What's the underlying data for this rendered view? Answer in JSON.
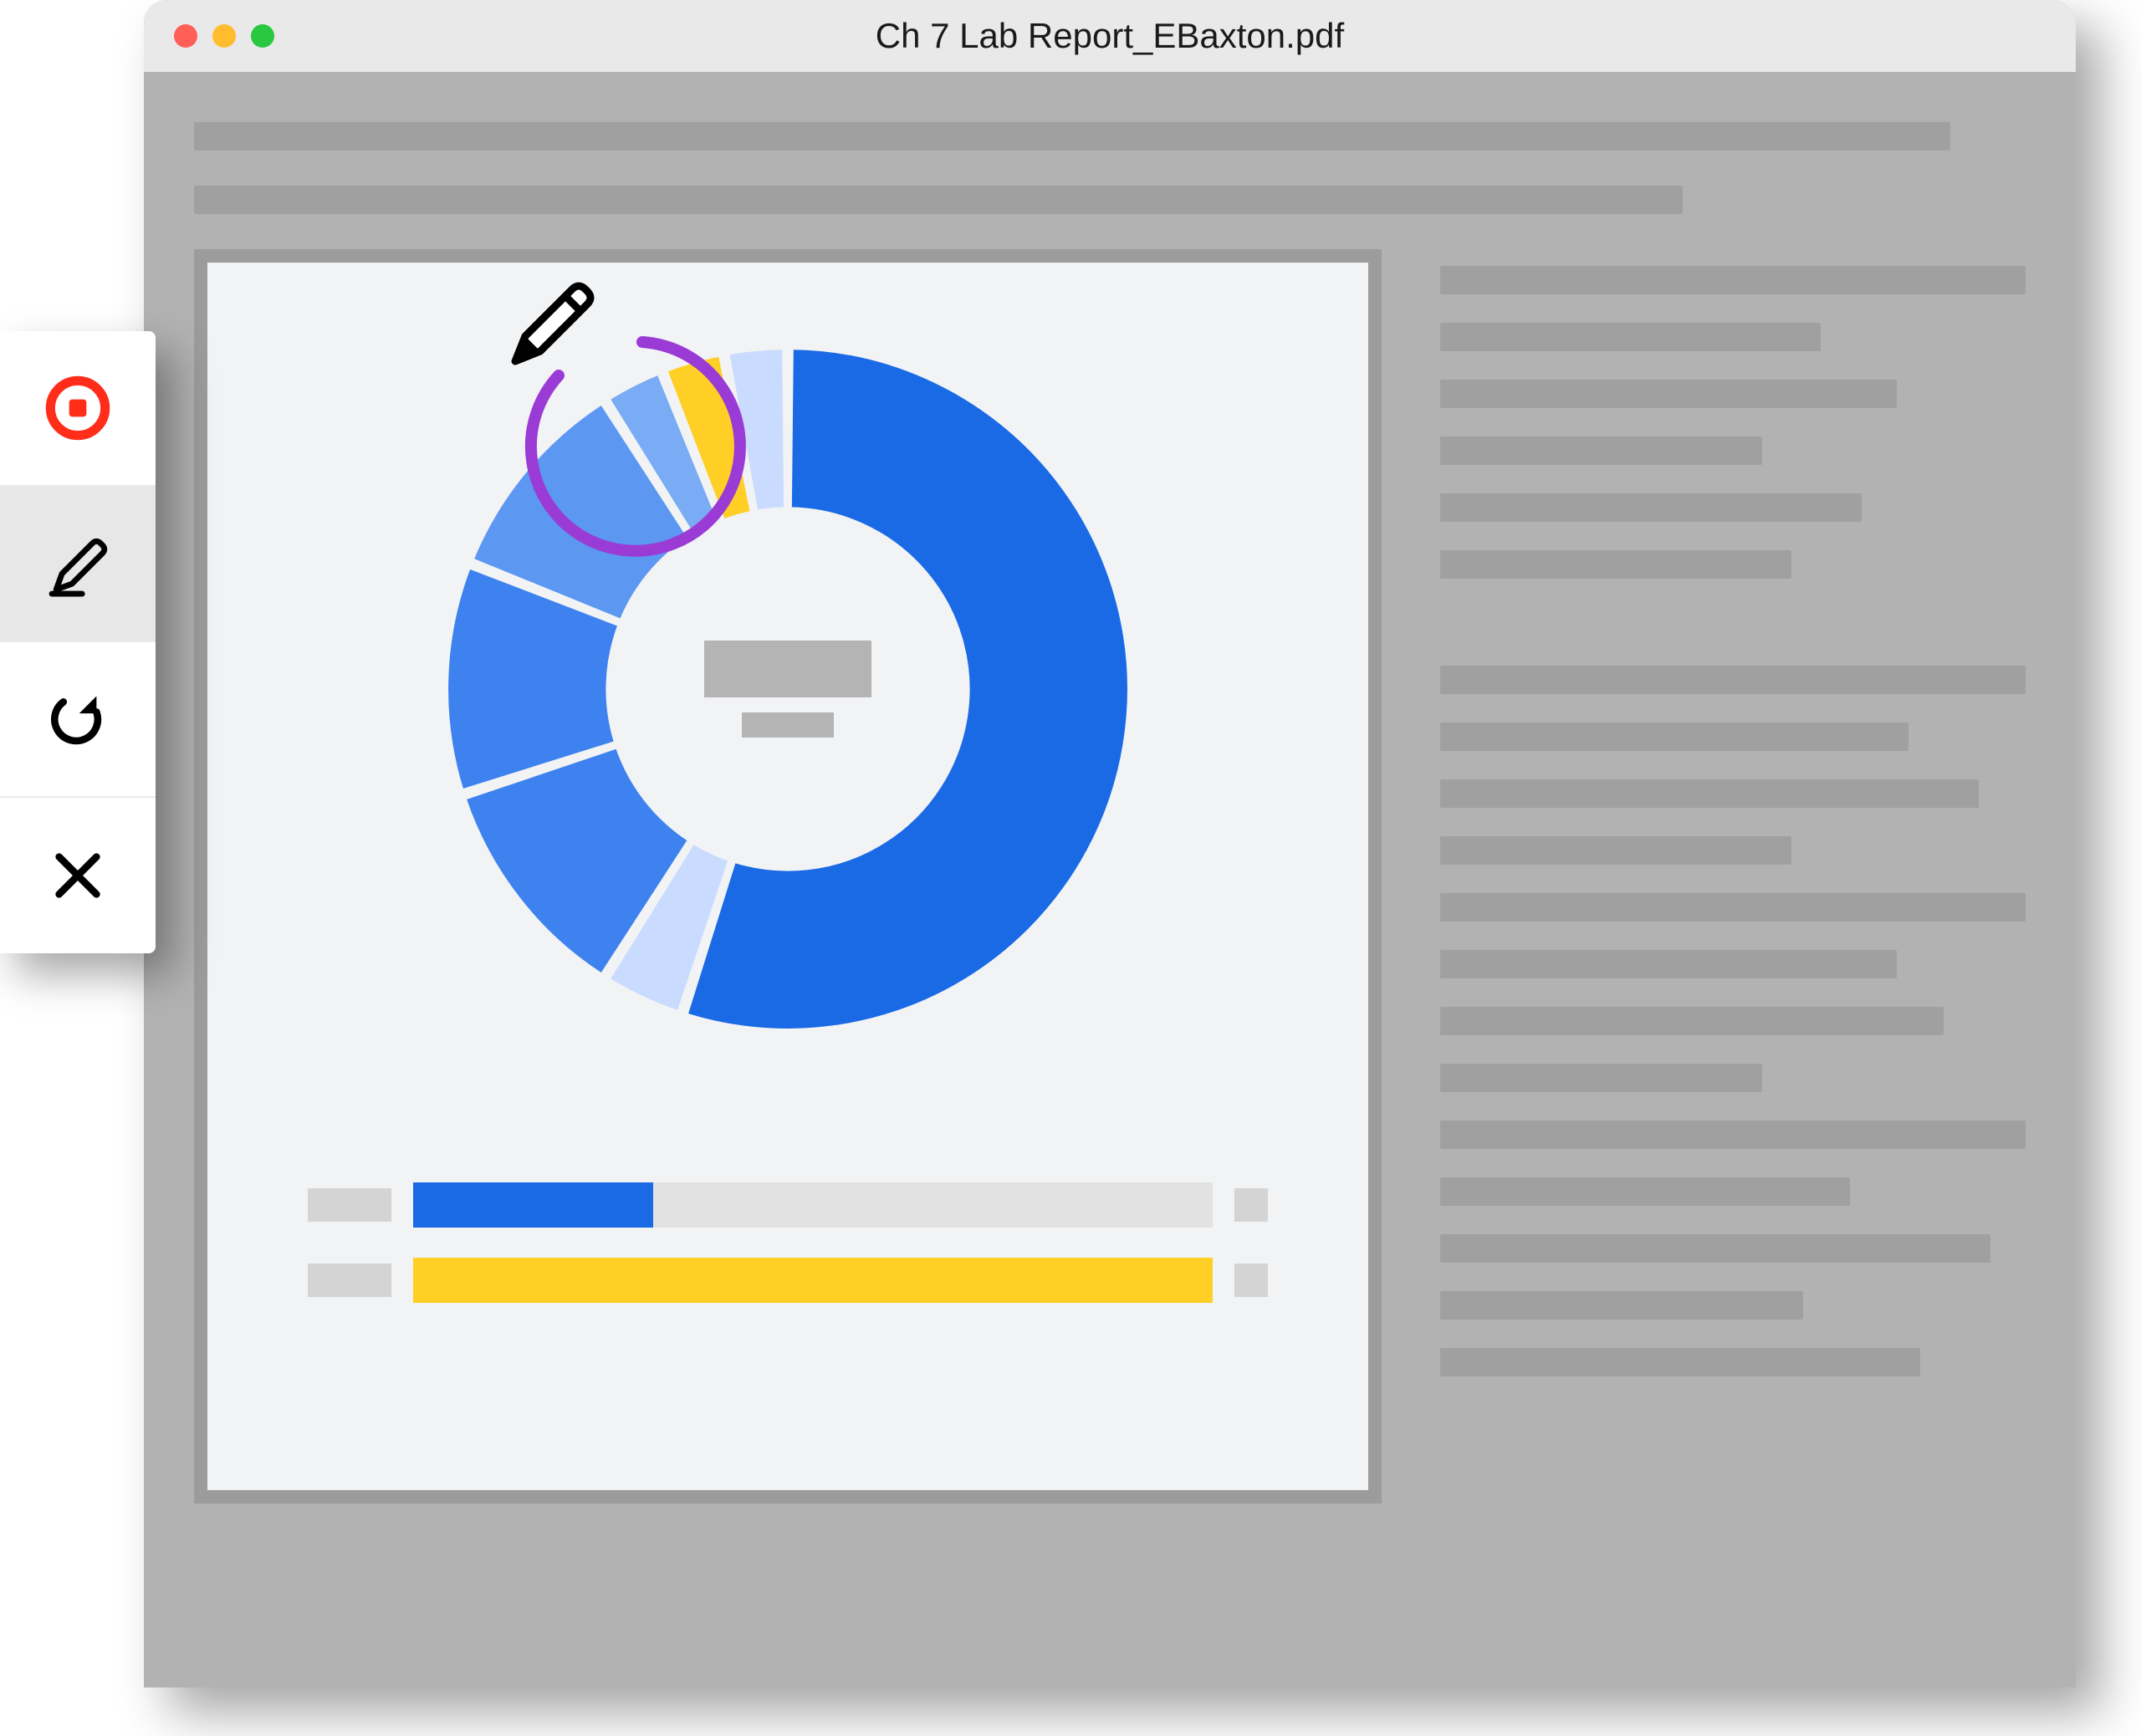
{
  "window": {
    "title": "Ch 7 Lab Report_EBaxton.pdf"
  },
  "toolbar": {
    "items": [
      {
        "name": "record-stop",
        "active": false
      },
      {
        "name": "pencil-annotate",
        "active": true
      },
      {
        "name": "redo",
        "active": false
      },
      {
        "name": "close",
        "active": false
      }
    ]
  },
  "annotation": {
    "tool": "pencil",
    "stroke_color": "#9a3bd6"
  },
  "chart_data": {
    "type": "donut",
    "title": "",
    "series": [
      {
        "name": "slice-1",
        "value": 55,
        "color": "#1a6ae6"
      },
      {
        "name": "slice-2",
        "value": 4,
        "color": "#c9dcff"
      },
      {
        "name": "slice-3",
        "value": 11,
        "color": "#3e82f0"
      },
      {
        "name": "slice-4",
        "value": 11,
        "color": "#3e82f0"
      },
      {
        "name": "slice-5",
        "value": 10,
        "color": "#5c97f2"
      },
      {
        "name": "slice-6",
        "value": 3,
        "color": "#7aabf5"
      },
      {
        "name": "slice-7",
        "value": 3,
        "color": "#ffcf26"
      },
      {
        "name": "slice-8",
        "value": 3,
        "color": "#c9dcff"
      }
    ],
    "center_labels": [
      "",
      ""
    ],
    "bars": [
      {
        "label": "",
        "value": 30,
        "color": "#1a6ae6"
      },
      {
        "label": "",
        "value": 100,
        "color": "#ffcf26"
      }
    ]
  },
  "sidebar_lines": {
    "widths_pct": [
      100,
      65,
      78,
      55,
      72,
      60,
      0,
      100,
      80,
      92,
      60,
      100,
      78,
      86,
      55,
      100,
      70,
      94,
      62,
      82
    ]
  }
}
